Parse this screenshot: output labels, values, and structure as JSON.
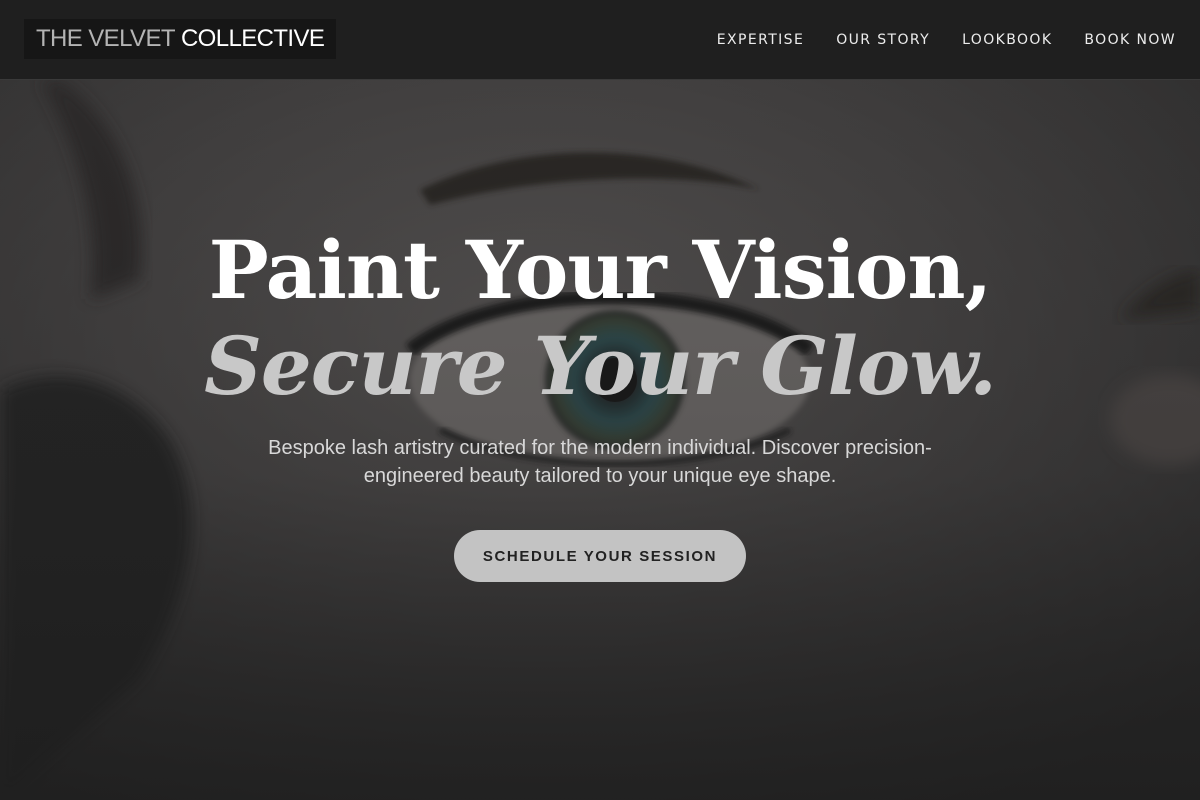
{
  "header": {
    "logo_part1": "THE VELVET",
    "logo_part2": "COLLECTIVE",
    "nav": [
      {
        "label": "EXPERTISE"
      },
      {
        "label": "OUR STORY"
      },
      {
        "label": "LOOKBOOK"
      },
      {
        "label": "BOOK NOW"
      }
    ]
  },
  "hero": {
    "headline_line1": "Paint Your Vision,",
    "headline_line2": "Secure Your Glow.",
    "subtitle": "Bespoke lash artistry curated for the modern individual. Discover precision-engineered beauty tailored to your unique eye shape.",
    "cta_label": "SCHEDULE YOUR SESSION"
  },
  "colors": {
    "header_bg": "#1f1f1f",
    "hero_bg": "#3b3a3a",
    "cta_bg": "#c3c3c3",
    "headline_accent": "#c8c8c8"
  }
}
